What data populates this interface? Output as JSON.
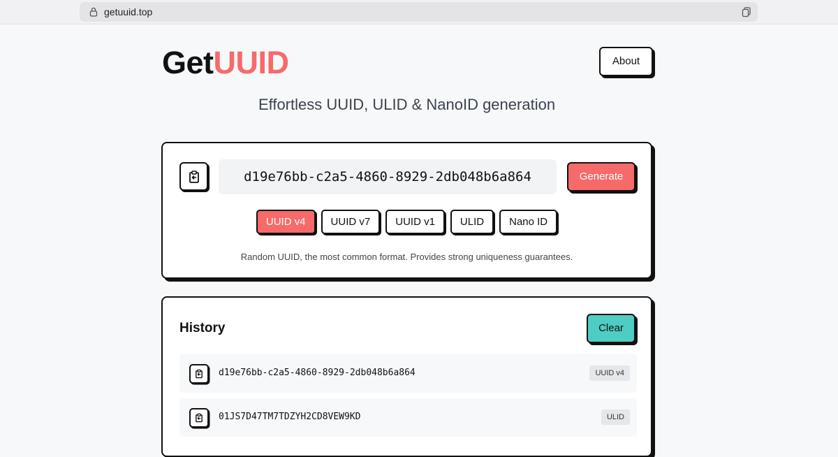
{
  "browser": {
    "url": "getuuid.top"
  },
  "header": {
    "logo_part1": "Get",
    "logo_part2": "UUID",
    "about_label": "About",
    "tagline": "Effortless UUID, ULID & NanoID generation"
  },
  "generator": {
    "current_value": "d19e76bb-c2a5-4860-8929-2db048b6a864",
    "generate_label": "Generate",
    "types": [
      {
        "label": "UUID v4",
        "active": true
      },
      {
        "label": "UUID v7",
        "active": false
      },
      {
        "label": "UUID v1",
        "active": false
      },
      {
        "label": "ULID",
        "active": false
      },
      {
        "label": "Nano ID",
        "active": false
      }
    ],
    "description": "Random UUID, the most common format. Provides strong uniqueness guarantees."
  },
  "history": {
    "title": "History",
    "clear_label": "Clear",
    "items": [
      {
        "value": "d19e76bb-c2a5-4860-8929-2db048b6a864",
        "type": "UUID v4"
      },
      {
        "value": "01JS7D47TM7TDZYH2CD8VEW9KD",
        "type": "ULID"
      }
    ]
  },
  "colors": {
    "accent": "#f76a6a",
    "clear": "#4ecdc4",
    "border": "#111111"
  }
}
